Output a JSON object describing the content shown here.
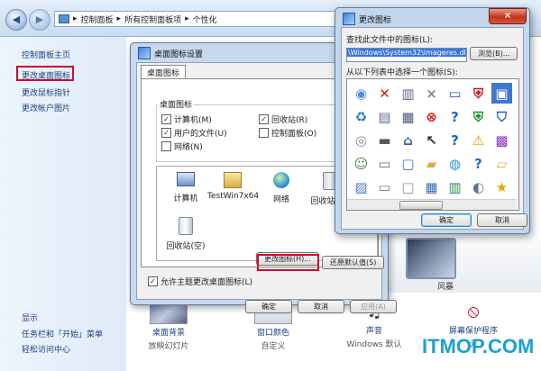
{
  "address_bar": {
    "crumbs": [
      "控制面板",
      "所有控制面板项",
      "个性化"
    ],
    "separator": "▸"
  },
  "left_pane": {
    "links": [
      "控制面板主页",
      "更改桌面图标",
      "更改鼠标指针",
      "更改帐户图片"
    ],
    "see_also": [
      "显示",
      "任务栏和「开始」菜单",
      "轻松访问中心"
    ]
  },
  "bottom_bar": [
    {
      "title": "桌面背景",
      "subtitle": "放映幻灯片"
    },
    {
      "title": "窗口颜色",
      "subtitle": "自定义"
    },
    {
      "title": "声音",
      "subtitle": "Windows 默认"
    },
    {
      "title": "屏幕保护程序",
      "subtitle": "无"
    }
  ],
  "wallpaper_label": "风暴",
  "desktop_icon_dialog": {
    "title": "桌面图标设置",
    "tab": "桌面图标",
    "group_label": "桌面图标",
    "checkboxes": [
      {
        "label": "计算机(M)",
        "checked": true
      },
      {
        "label": "回收站(R)",
        "checked": true
      },
      {
        "label": "用户的文件(U)",
        "checked": true
      },
      {
        "label": "控制面板(O)",
        "checked": false
      },
      {
        "label": "网络(N)",
        "checked": false
      }
    ],
    "icons": [
      "计算机",
      "TestWin7x64",
      "网络",
      "回收站(满)",
      "回收站(空)"
    ],
    "change_icon_button": "更改图标(H)...",
    "restore_default_button": "还原默认值(S)",
    "allow_themes": {
      "label": "允许主题更改桌面图标(L)",
      "checked": true
    },
    "ok": "确定",
    "cancel": "取消",
    "apply": "应用(A)"
  },
  "change_icon_dialog": {
    "title": "更改图标",
    "close_glyph": "×",
    "find_label": "查找此文件中的图标(L):",
    "path_value": "\\Windows\\System32\\imageres.dll",
    "browse_button": "浏览(B)...",
    "select_label": "从以下列表中选择一个图标(S):",
    "ok": "确定",
    "cancel": "取消",
    "selected_icon_index": 6
  },
  "watermark": "ITMOP.COM",
  "colors": {
    "highlight_red": "#c8102e",
    "selection_blue": "#3d78cf",
    "link_blue": "#1c3f80",
    "watermark_blue": "#1aa0d6"
  }
}
